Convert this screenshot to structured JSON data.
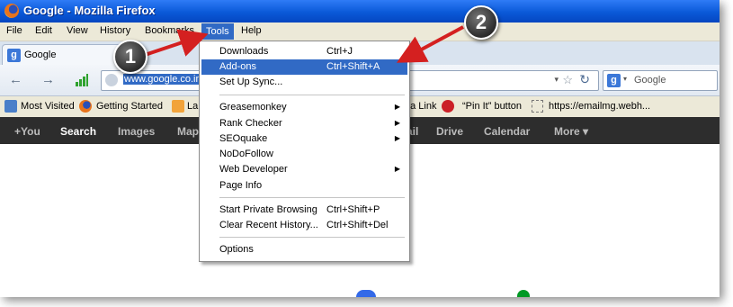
{
  "window": {
    "title": "Google - Mozilla Firefox",
    "icon": "firefox-icon"
  },
  "menubar": [
    "File",
    "Edit",
    "View",
    "History",
    "Bookmarks",
    "Tools",
    "Help"
  ],
  "tab": {
    "label": "Google",
    "icon": "google-icon"
  },
  "navbar": {
    "url": "www.google.co.in",
    "search_placeholder": "Google",
    "back_icon": "back-arrow-icon",
    "forward_icon": "forward-arrow-icon",
    "reload_icon": "reload-icon",
    "star_icon": "star-icon"
  },
  "bookmarks": [
    {
      "label": "Most Visited",
      "icon": "search-page-icon"
    },
    {
      "label": "Getting Started",
      "icon": "firefox-icon"
    },
    {
      "label": "La",
      "icon": "rss-icon"
    },
    {
      "label": "t a Link",
      "icon": ""
    },
    {
      "label": "“Pin It” button",
      "icon": "pinterest-icon"
    },
    {
      "label": "https://emailmg.webh...",
      "icon": "page-icon"
    }
  ],
  "google_bar": [
    "+You",
    "Search",
    "Images",
    "Map",
    "ail",
    "Drive",
    "Calendar",
    "More ▾"
  ],
  "tools_menu": [
    {
      "label": "Downloads",
      "shortcut": "Ctrl+J"
    },
    {
      "label": "Add-ons",
      "shortcut": "Ctrl+Shift+A"
    },
    {
      "label": "Set Up Sync...",
      "shortcut": ""
    },
    {
      "label": "Greasemonkey",
      "shortcut": ""
    },
    {
      "label": "Rank Checker",
      "shortcut": ""
    },
    {
      "label": "SEOquake",
      "shortcut": ""
    },
    {
      "label": "NoDoFollow",
      "shortcut": ""
    },
    {
      "label": "Web Developer",
      "shortcut": ""
    },
    {
      "label": "Page Info",
      "shortcut": ""
    },
    {
      "label": "Start Private Browsing",
      "shortcut": "Ctrl+Shift+P"
    },
    {
      "label": "Clear Recent History...",
      "shortcut": "Ctrl+Shift+Del"
    },
    {
      "label": "Options",
      "shortcut": ""
    }
  ],
  "callouts": [
    "1",
    "2"
  ],
  "colors": {
    "highlight": "#316ac5",
    "titlebar": "#0a59d8",
    "arrow": "#d42020",
    "google_bar": "#2d2d2d"
  }
}
